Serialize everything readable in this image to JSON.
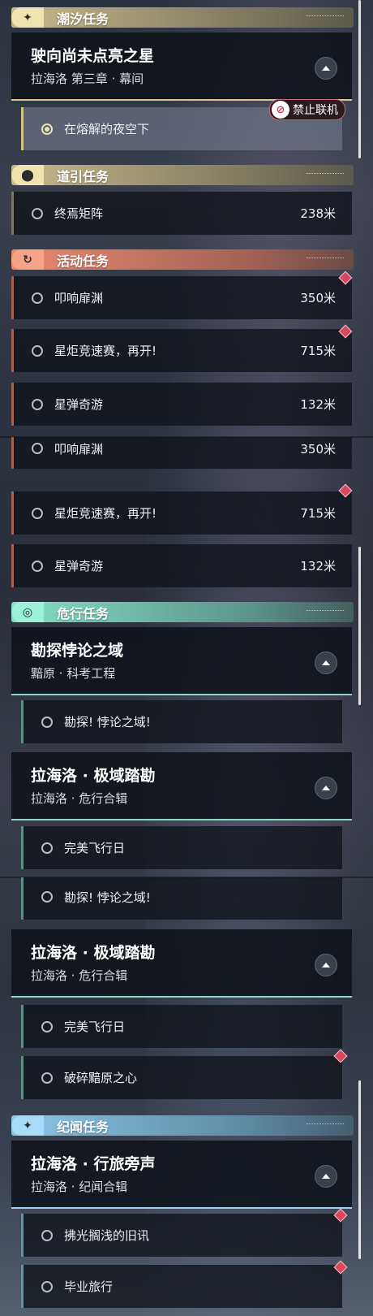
{
  "panel1": {
    "tide": {
      "icon": "sparkle-icon",
      "title": "潮汐任务",
      "card": {
        "title": "驶向尚未点亮之星",
        "subtitle": "拉海洛 第三章 · 幕间"
      },
      "active_item": "在熔解的夜空下",
      "badge": "禁止联机"
    },
    "guide": {
      "icon": "map-pin-icon",
      "title": "道引任务",
      "items": [
        {
          "label": "终焉矩阵",
          "distance": "238米"
        }
      ]
    },
    "event": {
      "icon": "refresh-icon",
      "title": "活动任务",
      "items": [
        {
          "label": "叩响扉渊",
          "distance": "350米"
        },
        {
          "label": "星炬竞速赛，再开!",
          "distance": "715米"
        },
        {
          "label": "星弹奇游",
          "distance": "132米"
        }
      ]
    }
  },
  "panel2": {
    "event_items": [
      {
        "label": "叩响扉渊",
        "distance": "350米"
      },
      {
        "label": "星炬竞速赛，再开!",
        "distance": "715米"
      },
      {
        "label": "星弹奇游",
        "distance": "132米"
      }
    ],
    "danger": {
      "icon": "eye-gear-icon",
      "title": "危行任务",
      "card1": {
        "title": "勘探悖论之域",
        "subtitle": "黯原 · 科考工程"
      },
      "card1_item": "勘探! 悖论之域!",
      "card2": {
        "title": "拉海洛 · 极域踏勘",
        "subtitle": "拉海洛 · 危行合辑"
      },
      "card2_item": "完美飞行日"
    }
  },
  "panel3": {
    "danger_item": "勘探! 悖论之域!",
    "card": {
      "title": "拉海洛 · 极域踏勘",
      "subtitle": "拉海洛 · 危行合辑"
    },
    "items": [
      "完美飞行日",
      "破碎黯原之心"
    ],
    "lore": {
      "icon": "sparkle-icon",
      "title": "纪闻任务",
      "card": {
        "title": "拉海洛 · 行旅旁声",
        "subtitle": "拉海洛 · 纪闻合辑"
      },
      "items": [
        "拂光搁浅的旧讯",
        "毕业旅行"
      ]
    }
  }
}
